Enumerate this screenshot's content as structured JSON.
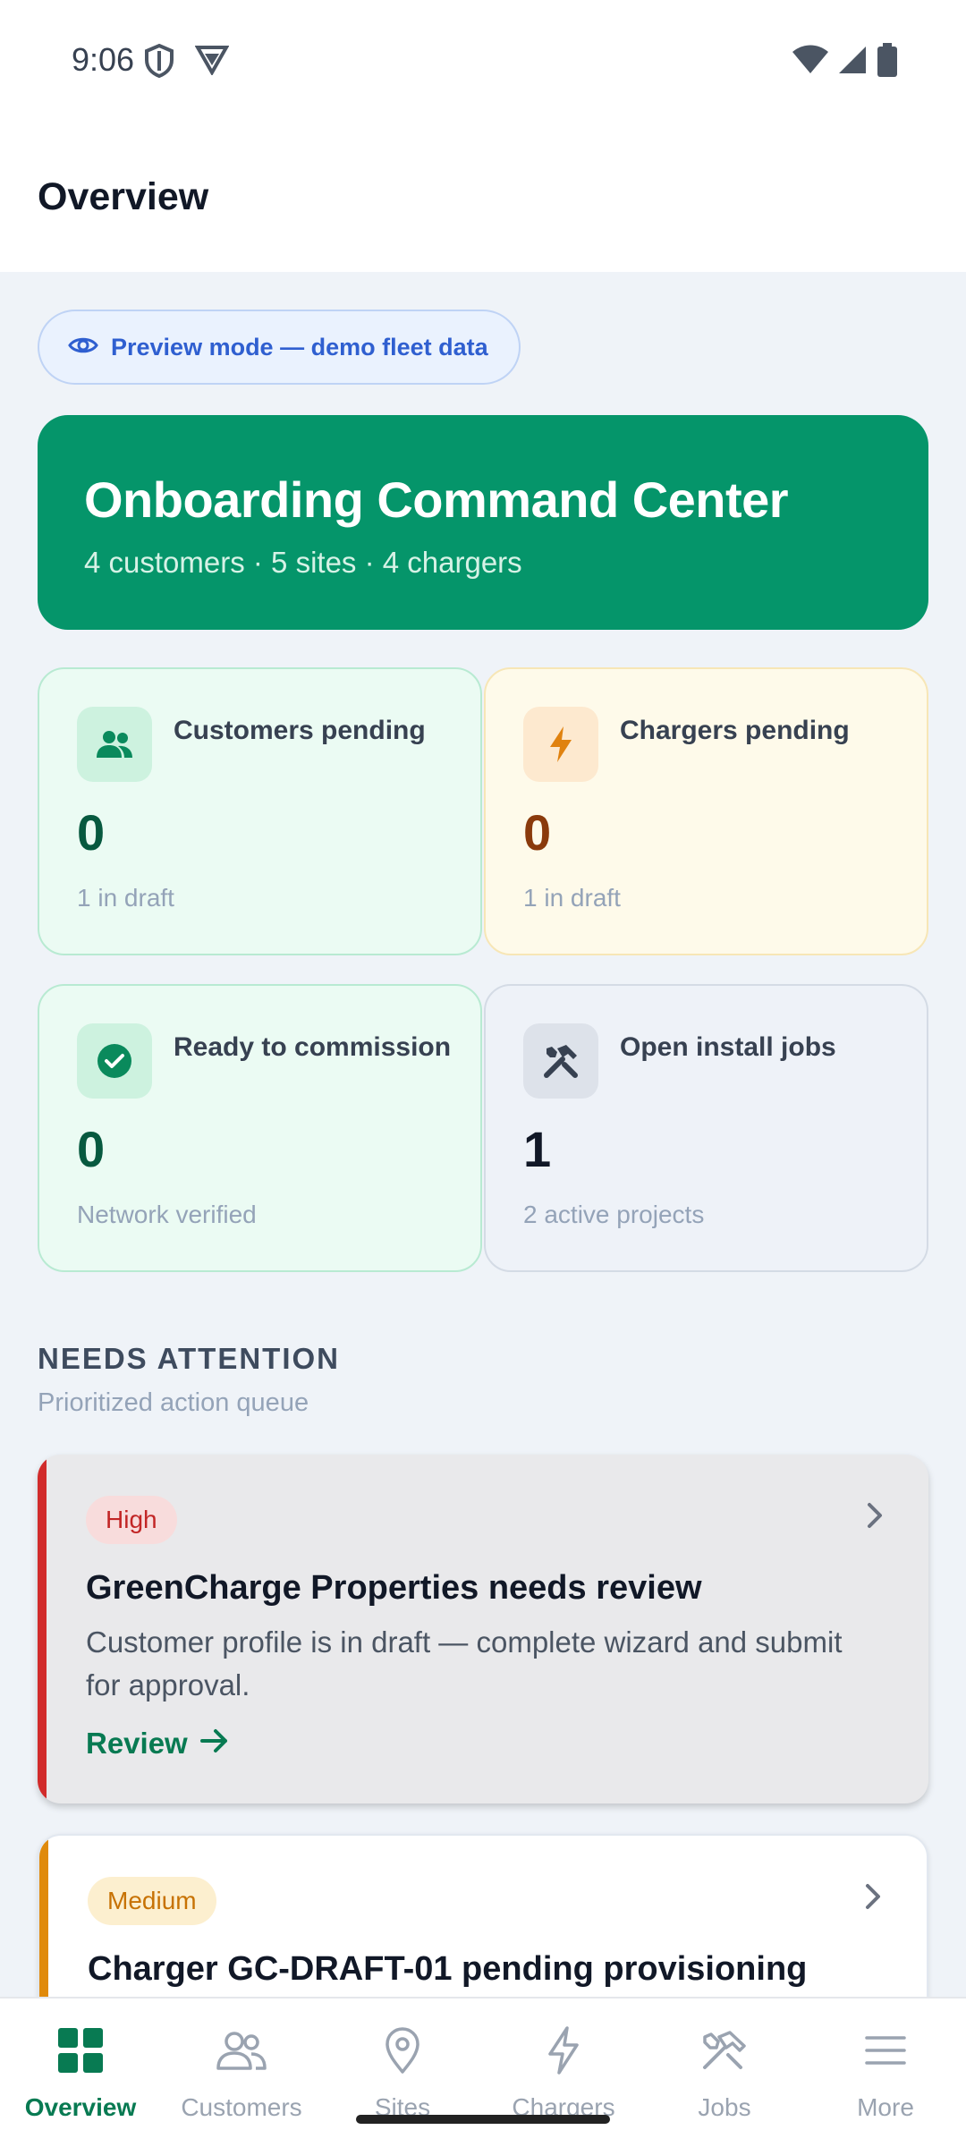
{
  "status_bar": {
    "time": "9:06"
  },
  "header": {
    "title": "Overview"
  },
  "preview": {
    "label": "Preview mode — demo fleet data"
  },
  "hero": {
    "title": "Onboarding Command Center",
    "subtitle": "4 customers · 5 sites · 4 chargers"
  },
  "stats": [
    {
      "label": "Customers pending",
      "value": "0",
      "note": "1 in draft",
      "icon": "users-icon",
      "color": "#0a8a5c"
    },
    {
      "label": "Chargers pending",
      "value": "0",
      "note": "1 in draft",
      "icon": "bolt-icon",
      "color": "#e0820f"
    },
    {
      "label": "Ready to commission",
      "value": "0",
      "note": "Network verified",
      "icon": "check-circle-icon",
      "color": "#0a8a5c"
    },
    {
      "label": "Open install jobs",
      "value": "1",
      "note": "2 active projects",
      "icon": "tools-icon",
      "color": "#374151"
    }
  ],
  "attention": {
    "title": "NEEDS ATTENTION",
    "subtitle": "Prioritized action queue",
    "items": [
      {
        "priority": "High",
        "title": "GreenCharge Properties needs review",
        "description": "Customer profile is in draft — complete wizard and submit for approval.",
        "action": "Review",
        "accent": "#d12b2b"
      },
      {
        "priority": "Medium",
        "title": "Charger GC-DRAFT-01 pending provisioning",
        "accent": "#e08a0b"
      }
    ]
  },
  "nav": {
    "items": [
      {
        "label": "Overview",
        "icon": "grid-icon",
        "active": true
      },
      {
        "label": "Customers",
        "icon": "users-icon"
      },
      {
        "label": "Sites",
        "icon": "map-pin-icon"
      },
      {
        "label": "Chargers",
        "icon": "bolt-icon"
      },
      {
        "label": "Jobs",
        "icon": "tools-icon"
      },
      {
        "label": "More",
        "icon": "menu-icon"
      }
    ]
  },
  "colors": {
    "accent": "#05956a",
    "active_nav": "#087a52",
    "background": "#eff3f8"
  }
}
